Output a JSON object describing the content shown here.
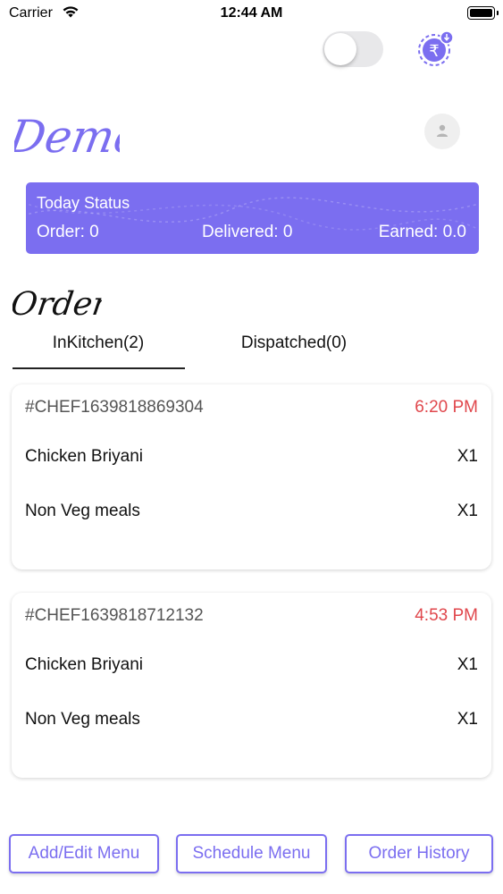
{
  "status_bar": {
    "carrier": "Carrier",
    "time": "12:44 AM"
  },
  "header": {
    "toggle_on": false,
    "wallet_icon": "rupee-wallet-icon",
    "wallet_badge_icon": "download-arrow-icon",
    "logo_text": "Demo",
    "profile_icon": "user-icon"
  },
  "today_status": {
    "title": "Today Status",
    "order": "Order: 0",
    "delivered": "Delivered: 0",
    "earned": "Earned: 0.0"
  },
  "orders": {
    "heading": "Orders",
    "tabs": [
      {
        "label": "InKitchen(2)",
        "active": true
      },
      {
        "label": "Dispatched(0)",
        "active": false
      }
    ],
    "list": [
      {
        "id": "#CHEF1639818869304",
        "time": "6:20 PM",
        "items": [
          {
            "name": "Chicken Briyani",
            "qty": "X1"
          },
          {
            "name": "Non Veg meals",
            "qty": "X1"
          }
        ]
      },
      {
        "id": "#CHEF1639818712132",
        "time": "4:53 PM",
        "items": [
          {
            "name": "Chicken Briyani",
            "qty": "X1"
          },
          {
            "name": "Non Veg meals",
            "qty": "X1"
          }
        ]
      }
    ]
  },
  "bottom_buttons": {
    "add_edit_menu": "Add/Edit Menu",
    "schedule_menu": "Schedule Menu",
    "order_history": "Order History"
  },
  "colors": {
    "accent": "#7b6ef0",
    "time_red": "#e0474c",
    "card_bg": "#ffffff"
  }
}
